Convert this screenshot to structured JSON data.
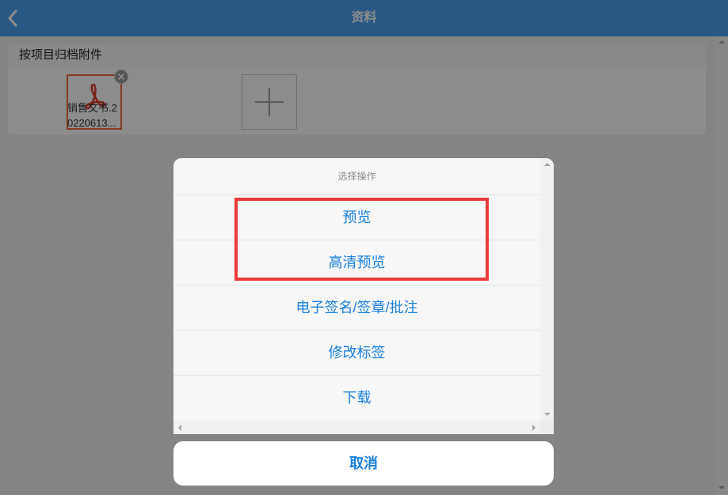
{
  "theme": {
    "header-bg": "#4ca0f3",
    "accent": "#1a80dc",
    "highlight": "#ea3b3b",
    "file-border": "#ee6a3c",
    "pdf-red": "#e0412a"
  },
  "header": {
    "back_icon": "chevron-left-icon",
    "title": "资料"
  },
  "attachments": {
    "section_title": "按项目归档附件",
    "files": [
      {
        "type_icon": "pdf-icon",
        "name_lines": [
          "销售文书.2",
          "0220613..."
        ],
        "badge_icon": "close-icon"
      }
    ],
    "add_icon": "plus-icon"
  },
  "action_sheet": {
    "title": "选择操作",
    "options": [
      {
        "label": "预览"
      },
      {
        "label": "高清预览"
      },
      {
        "label": "电子签名/签章/批注"
      },
      {
        "label": "修改标签"
      },
      {
        "label": "下载"
      }
    ],
    "cancel_label": "取消"
  },
  "scrollbar_icons": {
    "up": "arrow-up-icon",
    "down": "arrow-down-icon",
    "left": "arrow-left-icon",
    "right": "arrow-right-icon"
  }
}
